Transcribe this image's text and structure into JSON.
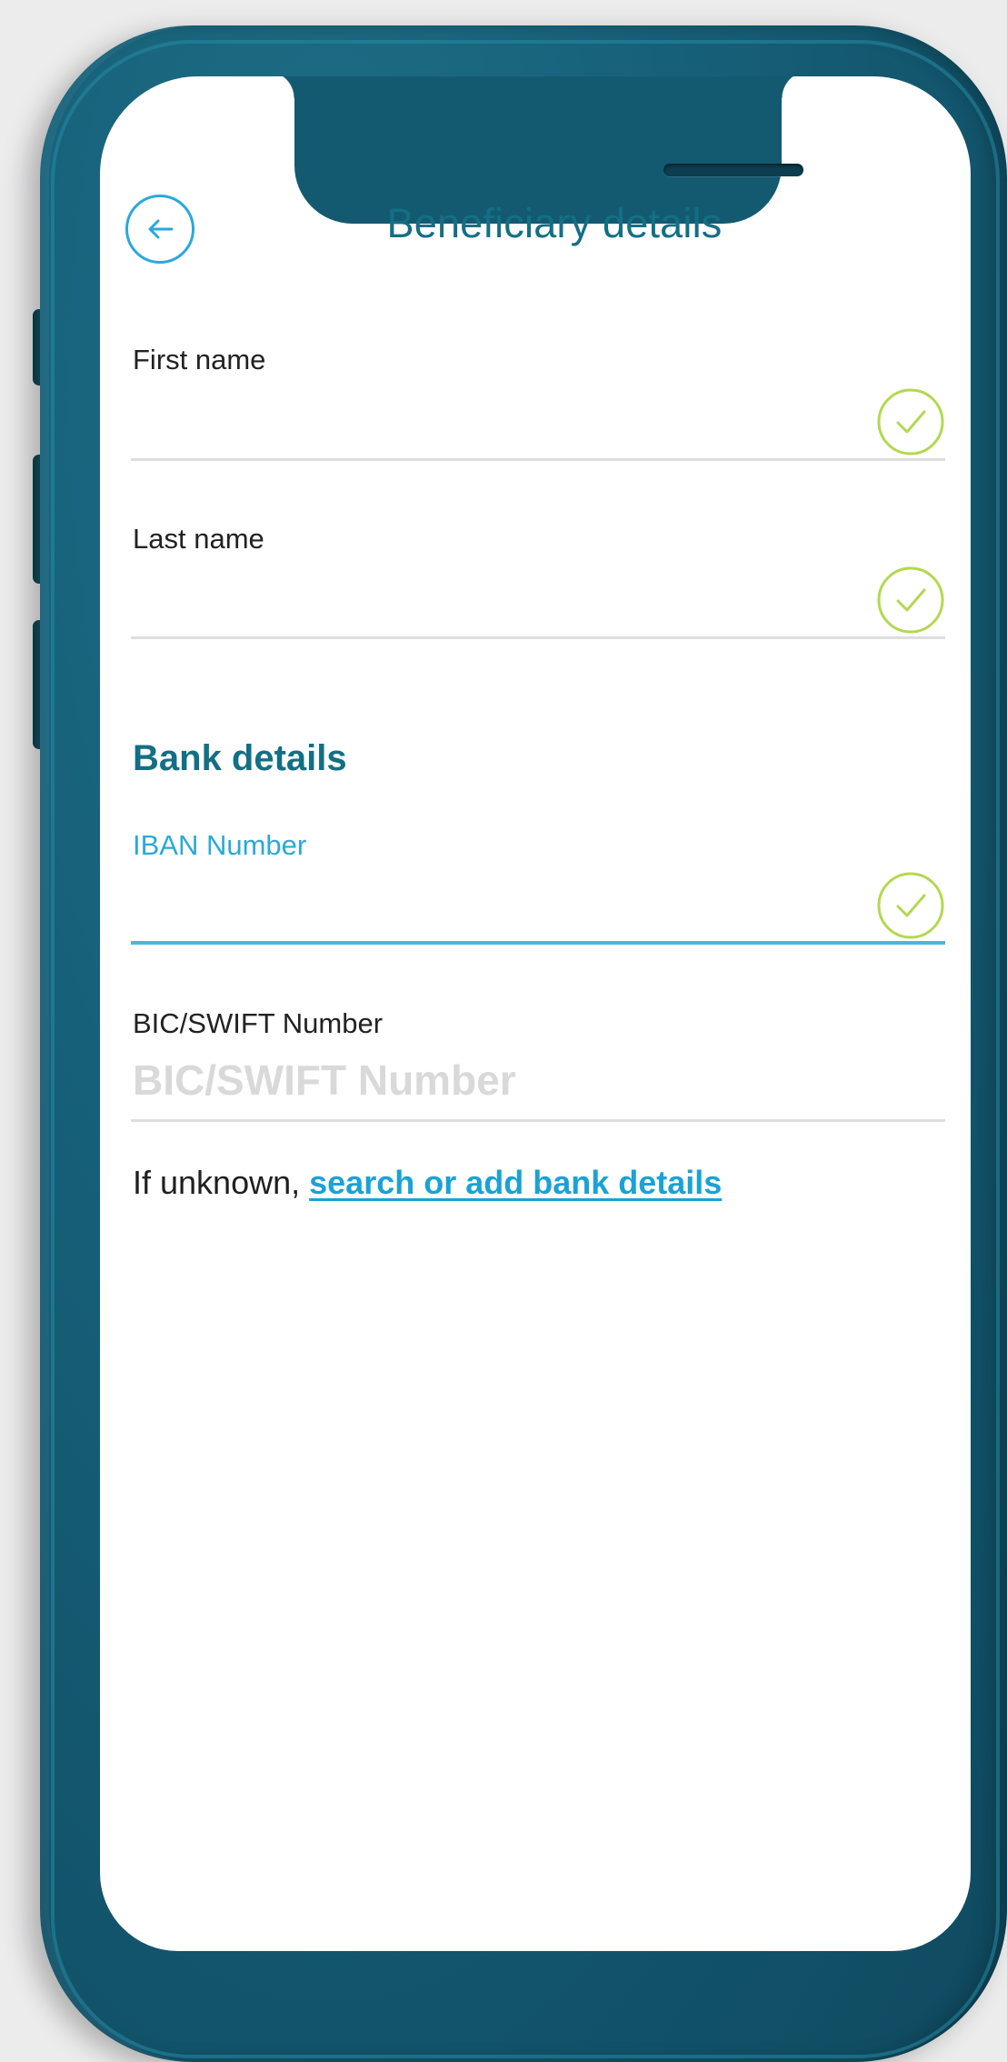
{
  "header": {
    "title": "Beneficiary details"
  },
  "fields": {
    "first_name": {
      "label": "First name",
      "value": ""
    },
    "last_name": {
      "label": "Last name",
      "value": ""
    },
    "iban": {
      "label": "IBAN Number",
      "value": ""
    },
    "bic": {
      "label": "BIC/SWIFT Number",
      "placeholder": "BIC/SWIFT Number",
      "value": ""
    }
  },
  "bank_section": {
    "title": "Bank details"
  },
  "help": {
    "prefix": "If unknown, ",
    "link_text": "search or add bank details"
  },
  "icons": {
    "back": "arrow-left-circle-icon",
    "valid": "check-circle-icon"
  },
  "colors": {
    "frame": "#17607a",
    "title": "#136f84",
    "accent": "#2aa8dd",
    "valid_check": "#b3d84f",
    "divider": "#dedede"
  }
}
